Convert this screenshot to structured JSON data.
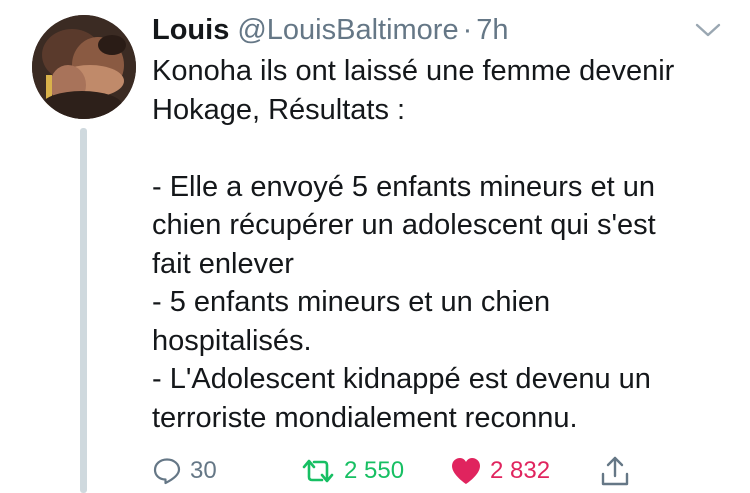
{
  "tweet": {
    "author": {
      "display_name": "Louis",
      "handle": "@LouisBaltimore",
      "separator": "·",
      "time": "7h"
    },
    "text": "Konoha ils ont laissé une femme devenir\nHokage, Résultats :\n\n- Elle a envoyé 5 enfants mineurs et un\nchien récupérer un adolescent qui s'est\nfait enlever\n- 5 enfants mineurs et un chien\nhospitalisés.\n- L'Adolescent kidnappé est devenu un\nterroriste mondialement reconnu.",
    "actions": {
      "reply_count": "30",
      "retweet_count": "2 550",
      "like_count": "2 832"
    }
  },
  "icons": {
    "menu": "chevron-down-icon",
    "reply": "reply-bubble-icon",
    "retweet": "retweet-icon",
    "like": "heart-icon",
    "share": "share-icon"
  },
  "colors": {
    "text": "#14171a",
    "secondary": "#657786",
    "retweet_active": "#17bf63",
    "like_active": "#e0245e",
    "thread_line": "#cfd9de"
  }
}
